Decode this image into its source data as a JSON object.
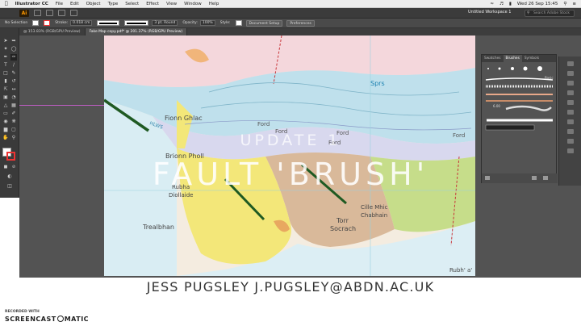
{
  "menubar": {
    "app_name": "Illustrator CC",
    "items": [
      "File",
      "Edit",
      "Object",
      "Type",
      "Select",
      "Effect",
      "View",
      "Window",
      "Help"
    ],
    "datetime": "Wed 26 Sep 15:45"
  },
  "appbar": {
    "logo": "Ai",
    "workspace": "Untitled Workspace 1",
    "search_placeholder": "Search Adobe Stock"
  },
  "controlbar": {
    "selection": "No Selection",
    "stroke_label": "Stroke:",
    "stroke_value": "0.018 cm",
    "brush_value": "3 pt. Round",
    "opacity_label": "Opacity:",
    "opacity_value": "100%",
    "style_label": "Style:",
    "document_setup": "Document Setup",
    "preferences": "Preferences"
  },
  "tabs": [
    {
      "label": "@ 153.83% (RGB/GPU Preview)"
    },
    {
      "label": "Fake Map copy.pdf* @ 201.37% (RGB/GPU Preview)"
    }
  ],
  "panel": {
    "tabs": [
      "Swatches",
      "Brushes",
      "Symbols"
    ],
    "brush_size": "6.00",
    "basic_label": "Basic"
  },
  "map": {
    "labels": {
      "fionn_ghlac": "Fionn Ghlac",
      "sprs": "Sprs",
      "ford1": "Ford",
      "ford2": "Ford",
      "ford3": "Ford",
      "ford4": "Ford",
      "ford5": "Ford",
      "brionn_pholl": "Brionn Pholl",
      "rubha_diollaide": "Rubha",
      "diollaide": "Diollaide",
      "trealbhan": "Trealbhan",
      "torr": "Torr",
      "socrach": "Socrach",
      "cille_mhic": "Cille Mhic",
      "chabhain": "Chabhain",
      "rubh_a": "Rubh' a'",
      "hlws": "HLWS"
    }
  },
  "overlay": {
    "subtitle": "UPDATE 1",
    "title": "FAULT 'BRUSH'",
    "credit": "JESS PUGSLEY J.PUGSLEY@ABDN.AC.UK"
  },
  "watermark": {
    "recorded_with": "RECORDED WITH",
    "brand_pre": "SCREENCAST",
    "brand_post": "MATIC"
  },
  "colors": {
    "ai_orange": "#ff9a00",
    "fault_line": "#1f5a22",
    "sea": "#c8e6f0",
    "yellow_geology": "#f3e779",
    "green_geology": "#c6dd8a",
    "pink_geology": "#f4d7dc",
    "brown_geology": "#d9b99a"
  }
}
